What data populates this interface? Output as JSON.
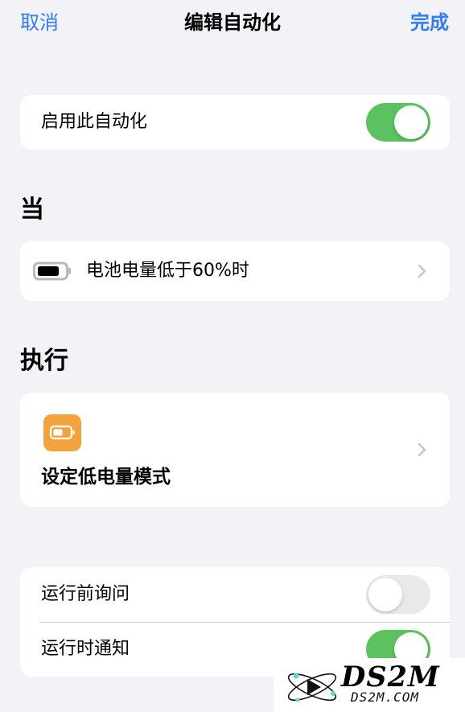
{
  "nav": {
    "cancel_label": "取消",
    "title": "编辑自动化",
    "done_label": "完成"
  },
  "enable": {
    "label": "启用此自动化",
    "toggle_on": true
  },
  "when": {
    "section_title": "当",
    "trigger_label": "电池电量低于60%时",
    "icon": "battery-icon"
  },
  "do": {
    "section_title": "执行",
    "action_label": "设定低电量模式",
    "icon": "low-power-mode-icon"
  },
  "options": {
    "ask_before_running_label": "运行前询问",
    "ask_before_running_on": false,
    "notify_when_run_label": "运行时通知",
    "notify_when_run_on": true
  },
  "watermark": {
    "title": "DS2M",
    "subtitle": "DS2M.COM"
  },
  "colors": {
    "accent": "#2f7cf6",
    "toggle_on": "#5ac25f",
    "toggle_off": "#e9e9ea",
    "background": "#f2f2f7",
    "app_icon": "#f3a33b"
  }
}
